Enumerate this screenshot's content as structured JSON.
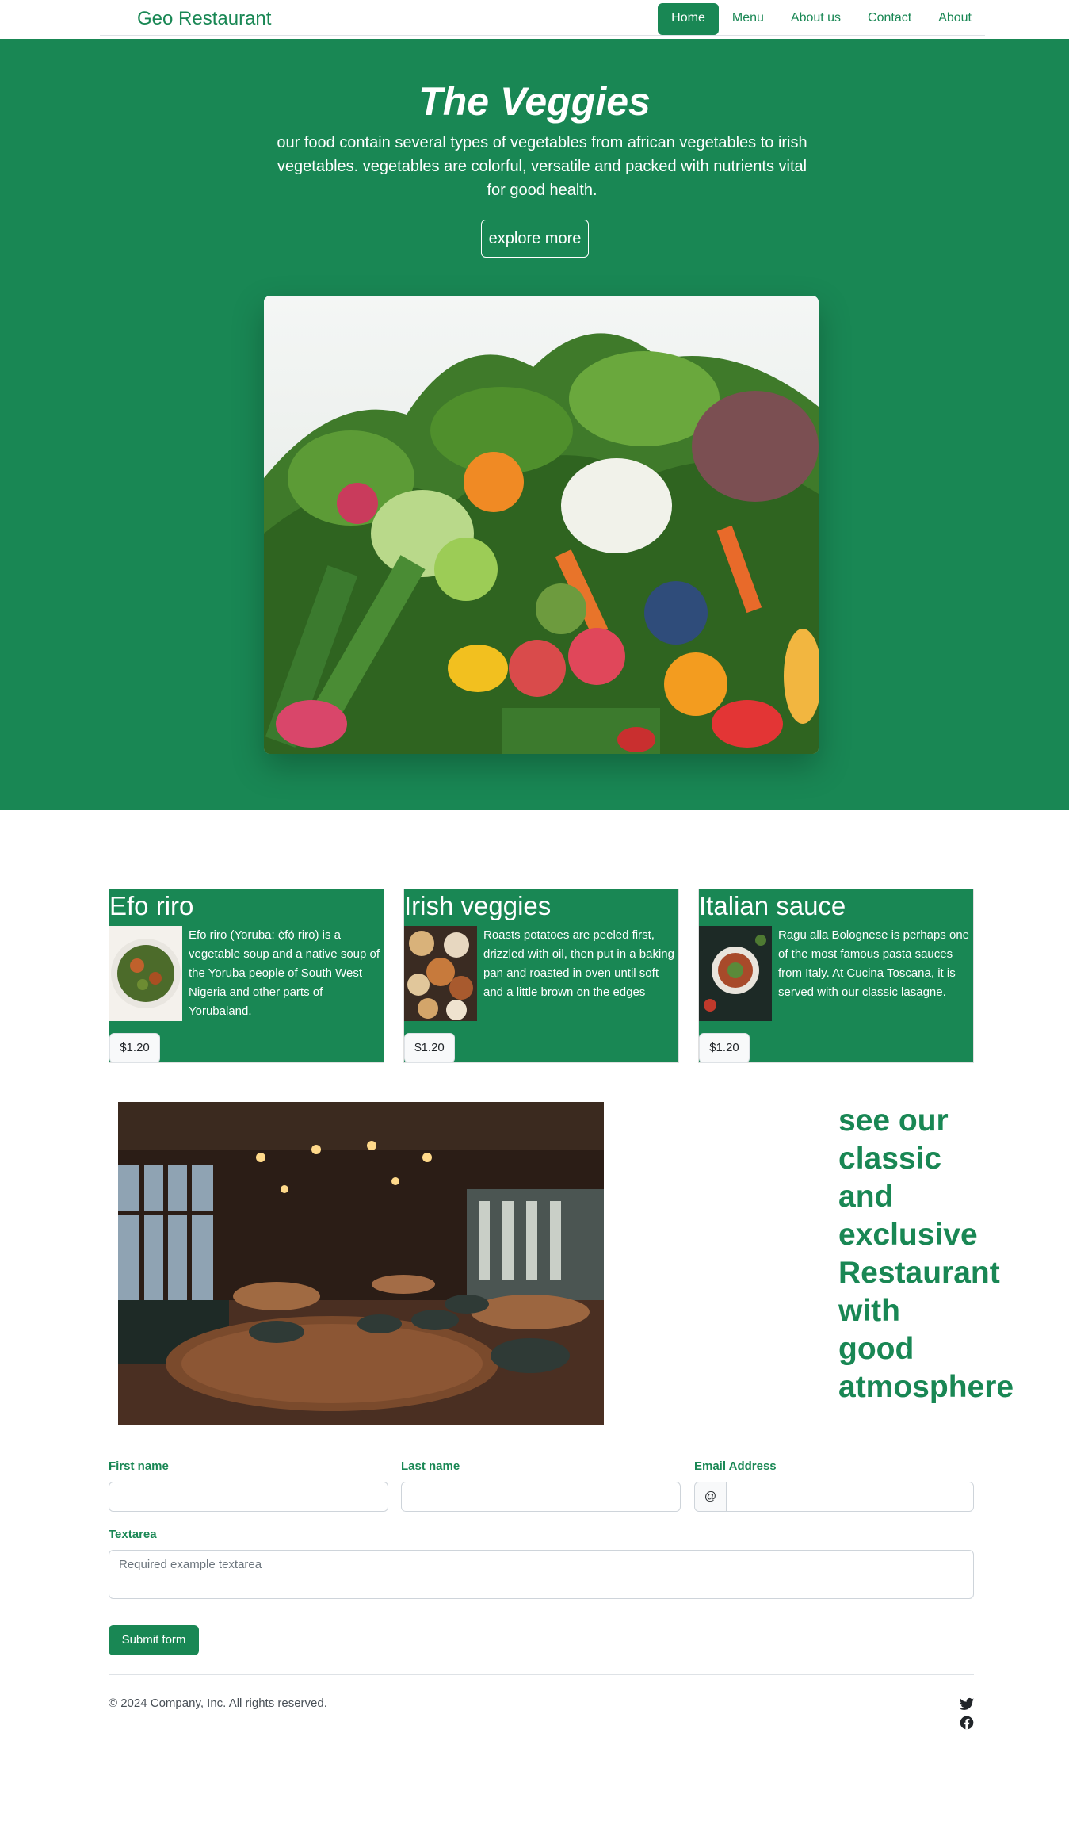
{
  "nav": {
    "brand": "Geo Restaurant",
    "links": [
      "Home",
      "Menu",
      "About us",
      "Contact",
      "About"
    ]
  },
  "hero": {
    "title": "The Veggies",
    "text": "our food contain several types of vegetables from african vegetables to irish vegetables. vegetables are colorful, versatile and packed with nutrients vital for good health.",
    "button": "explore more"
  },
  "cards": [
    {
      "title": "Efo riro",
      "text": "Efo riro (Yoruba: ẹ̀fọ́ riro) is a vegetable soup and a native soup of the Yoruba people of South West Nigeria and other parts of Yorubaland.",
      "price": "$1.20"
    },
    {
      "title": "Irish veggies",
      "text": "Roasts potatoes are peeled first, drizzled with oil, then put in a baking pan and roasted in oven until soft and a little brown on the edges",
      "price": "$1.20"
    },
    {
      "title": "Italian sauce",
      "text": "Ragu alla Bolognese is perhaps one of the most famous pasta sauces from Italy. At Cucina Toscana, it is served with our classic lasagne.",
      "price": "$1.20"
    }
  ],
  "promo": {
    "lines": [
      "see our",
      "classic",
      "and",
      "exclusive",
      "Restaurant",
      "with",
      "good",
      "atmosphere"
    ]
  },
  "form": {
    "first_name_label": "First name",
    "last_name_label": "Last name",
    "email_label": "Email Address",
    "at_symbol": "@",
    "textarea_label": "Textarea",
    "textarea_placeholder": "Required example textarea",
    "submit": "Submit form"
  },
  "footer": {
    "copyright": "© 2024 Company, Inc. All rights reserved.",
    "icons": [
      "twitter-icon",
      "facebook-icon"
    ]
  },
  "colors": {
    "brand": "#198754",
    "white": "#ffffff"
  }
}
